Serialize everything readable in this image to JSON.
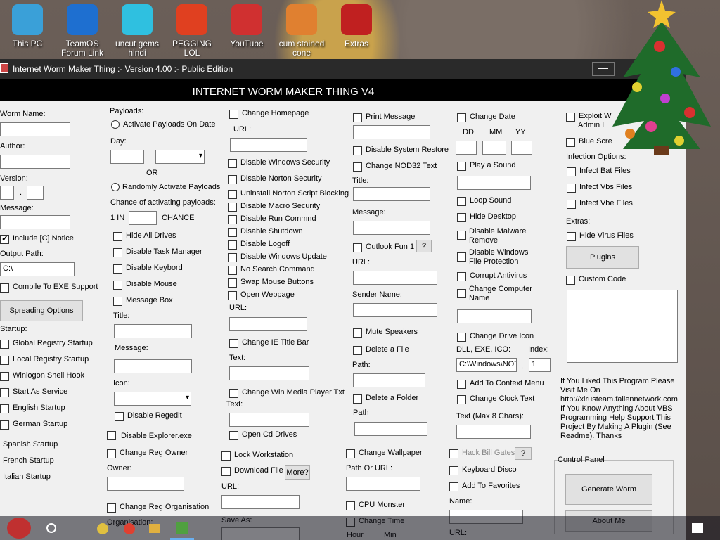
{
  "desktop": {
    "icons": [
      {
        "label": "This PC",
        "color": "#3aa0d8"
      },
      {
        "label": "TeamOS Forum Link",
        "color": "#1e6fd0"
      },
      {
        "label": "uncut gems hindi",
        "color": "#2fc0e0"
      },
      {
        "label": "PEGGING LOL",
        "color": "#e04020"
      },
      {
        "label": "YouTube",
        "color": "#d03030"
      },
      {
        "label": "cum stained cone",
        "color": "#e08030"
      },
      {
        "label": "Extras",
        "color": "#c02020"
      }
    ]
  },
  "window": {
    "title": "Internet Worm Maker Thing :- Version 4.00 :- Public Edition",
    "minimize": "—",
    "header": "INTERNET WORM MAKER THING V4"
  },
  "col1": {
    "worm_name": "Worm Name:",
    "author": "Author:",
    "version": "Version:",
    "dot": ".",
    "message": "Message:",
    "include_notice": "Include [C] Notice",
    "output_path": "Output Path:",
    "output_value": "C:\\",
    "compile": "Compile To EXE Support",
    "spreading": "Spreading Options",
    "startup": "Startup:",
    "startup_items": [
      "Global Registry Startup",
      "Local Registry Startup",
      "Winlogon Shell Hook",
      "Start As Service",
      "English Startup",
      "German Startup",
      "Spanish Startup",
      "French Startup",
      "Italian Startup"
    ]
  },
  "col2": {
    "payloads": "Payloads:",
    "activate_date": "Activate Payloads On Date",
    "day": "Day:",
    "or": "OR",
    "randomly": "Randomly Activate Payloads",
    "chance": "Chance of activating payloads:",
    "one_in": "1 IN",
    "chance_word": "CHANCE",
    "items": [
      "Hide All Drives",
      "Disable Task Manager",
      "Disable Keybord",
      "Disable Mouse",
      "Message Box"
    ],
    "title": "Title:",
    "message": "Message:",
    "icon": "Icon:",
    "disable_regedit": "Disable Regedit",
    "disable_explorer": "Disable Explorer.exe",
    "change_reg_owner": "Change Reg Owner",
    "owner": "Owner:",
    "change_reg_org": "Change Reg Organisation",
    "organisation": "Organisation:"
  },
  "col3": {
    "change_homepage": "Change Homepage",
    "url": "URL:",
    "items": [
      "Disable Windows Security",
      "Disable Norton Security",
      "Uninstall Norton Script Blocking",
      "Disable Macro Security",
      "Disable Run Commnd",
      "Disable Shutdown",
      "Disable Logoff",
      "Disable Windows Update",
      "No Search Command",
      "Swap Mouse Buttons",
      "Open Webpage"
    ],
    "url2": "URL:",
    "change_ie_title": "Change IE Title Bar",
    "text": "Text:",
    "change_wmp": "Change Win Media Player Txt",
    "text2": "Text:",
    "open_cd": "Open Cd Drives",
    "lock_ws": "Lock Workstation",
    "download_file": "Download File",
    "more": "More?",
    "url3": "URL:",
    "save_as": "Save As:"
  },
  "col4": {
    "print_message": "Print Message",
    "disable_sys_restore": "Disable System Restore",
    "change_nod32": "Change NOD32 Text",
    "title": "Title:",
    "message": "Message:",
    "outlook_fun": "Outlook Fun 1",
    "q": "?",
    "url": "URL:",
    "sender_name": "Sender Name:",
    "mute_speakers": "Mute Speakers",
    "delete_file": "Delete a File",
    "path": "Path:",
    "delete_folder": "Delete a Folder",
    "path2": "Path",
    "change_wallpaper": "Change Wallpaper",
    "path_or_url": "Path Or URL:",
    "cpu_monster": "CPU Monster",
    "change_time": "Change Time",
    "hour": "Hour",
    "min": "Min"
  },
  "col5": {
    "change_date": "Change Date",
    "dd": "DD",
    "mm": "MM",
    "yy": "YY",
    "play_sound": "Play a Sound",
    "loop_sound": "Loop Sound",
    "hide_desktop": "Hide Desktop",
    "disable_malware": "Disable Malware Remove",
    "disable_wfp": "Disable Windows File Protection",
    "corrupt_av": "Corrupt Antivirus",
    "change_comp_name": "Change Computer Name",
    "change_drive_icon": "Change Drive Icon",
    "dll_exe": "DLL, EXE, ICO:",
    "index": "Index:",
    "dll_value": "C:\\Windows\\NOT",
    "comma": ",",
    "index_value": "1",
    "context_menu": "Add To Context Menu",
    "clock_text": "Change Clock Text",
    "text_max": "Text (Max 8 Chars):",
    "hack_bill": "Hack Bill Gates",
    "q": "?",
    "keyboard_disco": "Keyboard Disco",
    "add_favorites": "Add To Favorites",
    "name": "Name:",
    "url": "URL:"
  },
  "col6": {
    "exploit": "Exploit W",
    "admin": "Admin L",
    "blue_screen": "Blue Scre",
    "infection": "Infection Options:",
    "infect": [
      "Infect Bat Files",
      "Infect Vbs Files",
      "Infect Vbe Files"
    ],
    "extras": "Extras:",
    "hide_virus": "Hide Virus Files",
    "plugins": "Plugins",
    "custom_code": "Custom Code",
    "promo": "If You Liked This Program Please Visit Me On http://xirusteam.fallennetwork.com If You Know Anything About VBS Programming Help Support This Project By Making A Plugin (See Readme). Thanks",
    "control_panel": "Control Panel",
    "generate": "Generate Worm",
    "about": "About Me"
  }
}
